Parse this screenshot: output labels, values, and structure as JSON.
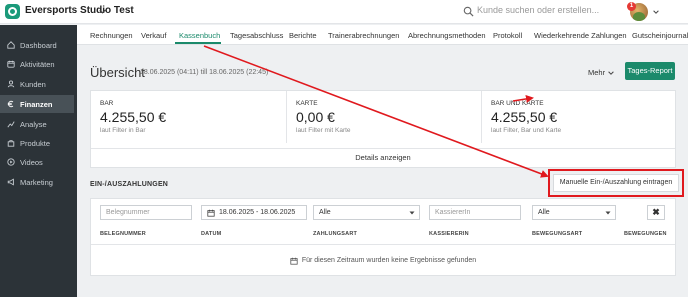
{
  "topbar": {
    "studio_name": "Eversports Studio Test",
    "search_placeholder": "Kunde suchen oder erstellen...",
    "notification_count": "1"
  },
  "sidebar": {
    "items": [
      {
        "label": "Dashboard",
        "icon": "dashboard-icon"
      },
      {
        "label": "Aktivitäten",
        "icon": "activities-icon"
      },
      {
        "label": "Kunden",
        "icon": "customers-icon"
      },
      {
        "label": "Finanzen",
        "icon": "finance-icon",
        "active": true
      },
      {
        "label": "Analyse",
        "icon": "analytics-icon"
      },
      {
        "label": "Produkte",
        "icon": "products-icon"
      },
      {
        "label": "Videos",
        "icon": "videos-icon"
      },
      {
        "label": "Marketing",
        "icon": "marketing-icon"
      }
    ]
  },
  "tabs": [
    {
      "label": "Rechnungen"
    },
    {
      "label": "Verkauf"
    },
    {
      "label": "Kassenbuch",
      "active": true
    },
    {
      "label": "Tagesabschluss"
    },
    {
      "label": "Berichte"
    },
    {
      "label": "Trainerabrechnungen"
    },
    {
      "label": "Abrechnungsmethoden"
    },
    {
      "label": "Protokoll"
    },
    {
      "label": "Wiederkehrende Zahlungen"
    },
    {
      "label": "Gutscheinjournal"
    }
  ],
  "overview": {
    "title": "Übersicht",
    "date_range": "18.06.2025 (04:11) till 18.06.2025 (22:45)",
    "more_label": "Mehr",
    "report_button": "Tages-Report"
  },
  "stats": [
    {
      "label": "BAR",
      "value": "4.255,50 €",
      "sub": "laut Filter in Bar"
    },
    {
      "label": "KARTE",
      "value": "0,00 €",
      "sub": "laut Filter mit Karte"
    },
    {
      "label": "BAR UND KARTE",
      "value": "4.255,50 €",
      "sub": "laut Filter, Bar und Karte"
    }
  ],
  "details_label": "Details anzeigen",
  "payments": {
    "section_title": "EIN-/AUSZAHLUNGEN",
    "manual_button": "Manuelle Ein-/Auszahlung eintragen",
    "filters": {
      "receipt_placeholder": "Belegnummer",
      "date_value": "18.06.2025 - 18.06.2025",
      "payment_type_value": "Alle",
      "cashier_placeholder": "KassiererIn",
      "movement_type_value": "Alle",
      "clear_label": "✖"
    },
    "columns": [
      "BELEGNUMMER",
      "DATUM",
      "ZAHLUNGSART",
      "KASSIERERIN",
      "BEWEGUNGSART",
      "BEWEGUNGEN"
    ],
    "empty_message": "Für diesen Zeitraum wurden keine Ergebnisse gefunden"
  },
  "colors": {
    "accent": "#1b8a6b",
    "sidebar_bg": "#2c3338",
    "annotation_red": "#e0191e"
  }
}
